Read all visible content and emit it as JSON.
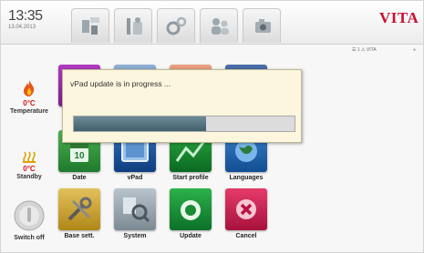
{
  "header": {
    "time": "13:35",
    "date": "13.04.2013",
    "tabs": [
      {
        "icon": "program-icon"
      },
      {
        "icon": "tools-icon"
      },
      {
        "icon": "settings-gears-icon"
      },
      {
        "icon": "users-icon"
      },
      {
        "icon": "camera-icon"
      }
    ],
    "logo": "VITA",
    "status": "☰ 1  ⚠ VITA"
  },
  "sidebar": {
    "temperature": {
      "value": "0°C",
      "label": "Temperature"
    },
    "standby": {
      "value": "0°C",
      "label": "Standby"
    },
    "switch_off": {
      "label": "Switch off"
    }
  },
  "grid": {
    "row2": [
      {
        "label": "Date",
        "icon": "calendar-icon"
      },
      {
        "label": "vPad",
        "icon": "vpad-icon"
      },
      {
        "label": "Start profile",
        "icon": "start-profile-icon"
      },
      {
        "label": "Languages",
        "icon": "languages-icon"
      }
    ],
    "row3": [
      {
        "label": "Base sett.",
        "icon": "base-settings-icon"
      },
      {
        "label": "System",
        "icon": "system-icon"
      },
      {
        "label": "Update",
        "icon": "update-icon"
      },
      {
        "label": "Cancel",
        "icon": "cancel-icon"
      }
    ]
  },
  "dialog": {
    "message": "vPad update is in progress ...",
    "progress": 0.6
  },
  "colors": {
    "accent_red": "#c8102e",
    "dialog_bg": "#fbf6dd",
    "progress_fill": "#4e6c79"
  }
}
